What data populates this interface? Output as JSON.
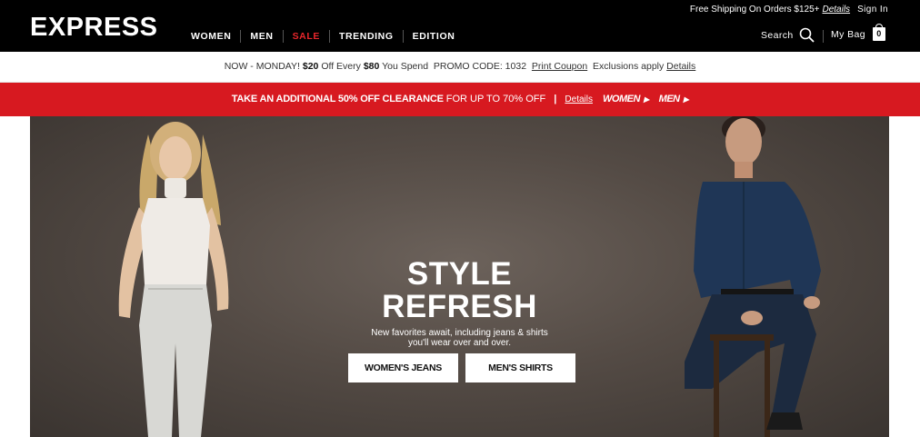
{
  "header": {
    "logo": "EXPRESS",
    "nav": [
      "WOMEN",
      "MEN",
      "SALE",
      "TRENDING",
      "EDITION"
    ],
    "utility": {
      "shipping": "Free Shipping On Orders $125+",
      "details": "Details",
      "sign_in": "Sign In"
    },
    "search_label": "Search",
    "bag_label": "My Bag",
    "bag_count": "0",
    "colors": {
      "bar": "#000000",
      "sale": "#e8262b"
    }
  },
  "promo": {
    "lead": "NOW - MONDAY!",
    "amount": "$20",
    "mid": "Off Every",
    "threshold": "$80",
    "spend": "You Spend",
    "code_text": "PROMO CODE: 1032",
    "print": "Print Coupon",
    "exclusions": "Exclusions apply",
    "details": "Details"
  },
  "banner": {
    "strong": "TAKE AN ADDITIONAL 50% OFF CLEARANCE",
    "rest": "FOR UP TO 70% OFF",
    "separator": "|",
    "details": "Details",
    "women": "WOMEN",
    "men": "MEN",
    "color": "#d71920"
  },
  "hero": {
    "title_line1": "STYLE",
    "title_line2": "REFRESH",
    "subtitle_line1": "New favorites await, including jeans & shirts",
    "subtitle_line2": "you'll wear over and over.",
    "cta_women": "WOMEN'S JEANS",
    "cta_men": "MEN'S SHIRTS"
  }
}
